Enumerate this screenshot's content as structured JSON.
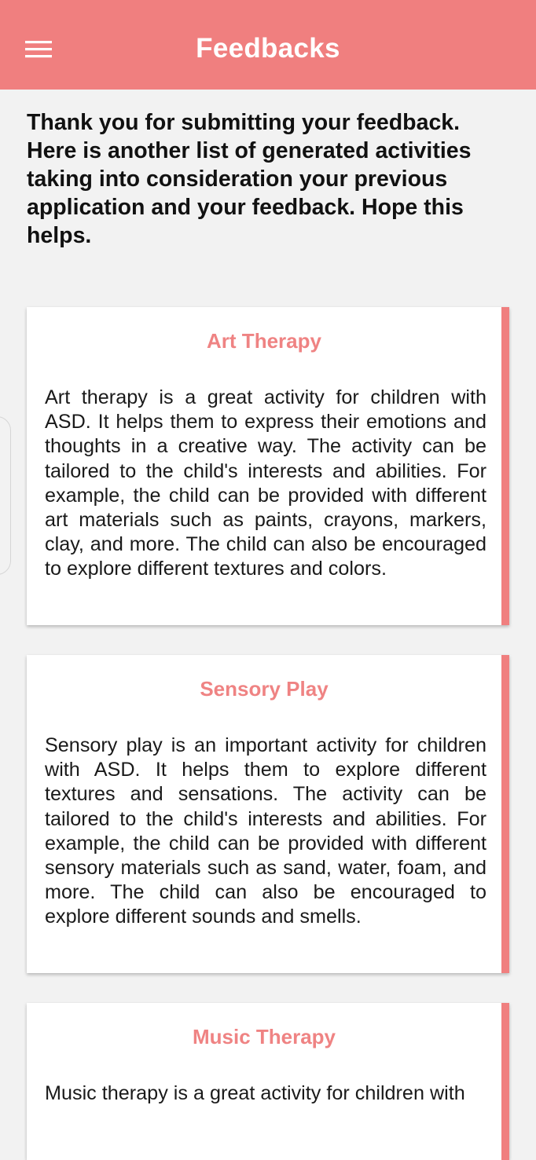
{
  "app_bar": {
    "title": "Feedbacks",
    "menu_icon": "menu-icon",
    "color": "#f07f7f"
  },
  "intro_text": "Thank you for submitting your feedback. Here is another list of generated activities taking into consideration your previous application and your feedback. Hope this helps.",
  "accent_color": "#f07f7f",
  "activities": [
    {
      "title": "Art Therapy",
      "description": "Art therapy is a great activity for children with ASD. It helps them to express their emotions and thoughts in a creative way. The activity can be tailored to the child's interests and abilities. For example, the child can be provided with different art materials such as paints, crayons, markers, clay, and more. The child can also be encouraged to explore different textures and colors."
    },
    {
      "title": "Sensory Play",
      "description": "Sensory play is an important activity for children with ASD. It helps them to explore different textures and sensations. The activity can be tailored to the child's interests and abilities. For example, the child can be provided with different sensory materials such as sand, water, foam, and more. The child can also be encouraged to explore different sounds and smells."
    },
    {
      "title": "Music Therapy",
      "description": "Music therapy is a great activity for children with"
    }
  ]
}
